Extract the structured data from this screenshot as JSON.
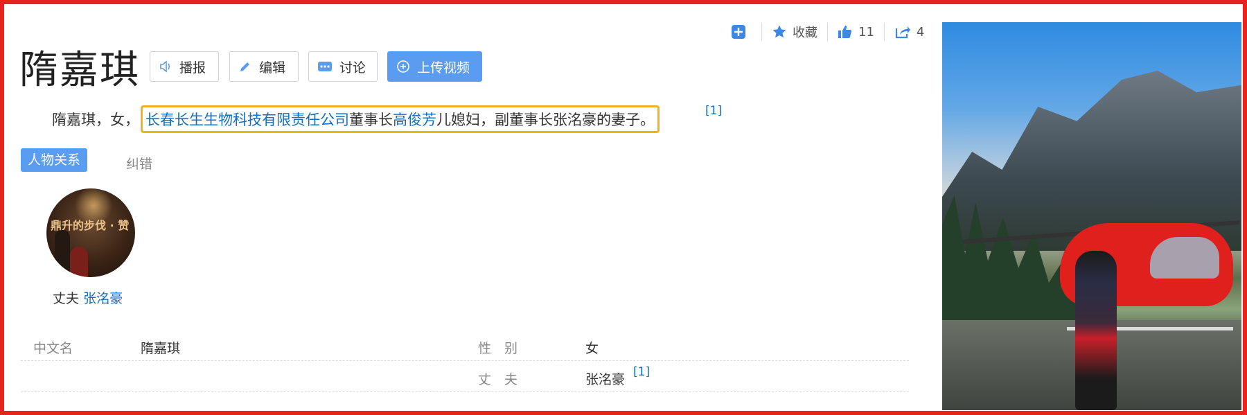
{
  "header": {
    "title": "隋嘉琪",
    "buttons": [
      {
        "label": "播报",
        "icon": "speaker-icon"
      },
      {
        "label": "编辑",
        "icon": "pencil-icon"
      },
      {
        "label": "讨论",
        "icon": "chat-icon"
      },
      {
        "label": "上传视频",
        "icon": "plus-circle-icon"
      }
    ]
  },
  "toolbar": {
    "add_icon": "plus-square-icon",
    "favorite_label": "收藏",
    "like_count": "11",
    "share_count": "4"
  },
  "summary": {
    "prefix": "隋嘉琪，女，",
    "company_link": "长春长生生物科技有限责任公司",
    "mid1": "董事长",
    "person_link": "高俊芳",
    "suffix": "儿媳妇，副董事长张洺豪的妻子。",
    "ref": "[1]"
  },
  "relations": {
    "tab_active": "人物关系",
    "tab_correct": "纠错",
    "person": {
      "relation": "丈夫",
      "name": "张洺豪"
    }
  },
  "infobox": {
    "rows": [
      {
        "label1": "中文名",
        "value1": "隋嘉琪",
        "label2": "性　别",
        "value2": "女"
      },
      {
        "label1": "",
        "value1": "",
        "label2": "丈　夫",
        "value2": "张洺豪",
        "ref": "[1]"
      }
    ]
  },
  "colors": {
    "accent": "#5a9cef",
    "link": "#136ec2",
    "highlight": "#f2b21b",
    "frame": "#e8231e"
  }
}
